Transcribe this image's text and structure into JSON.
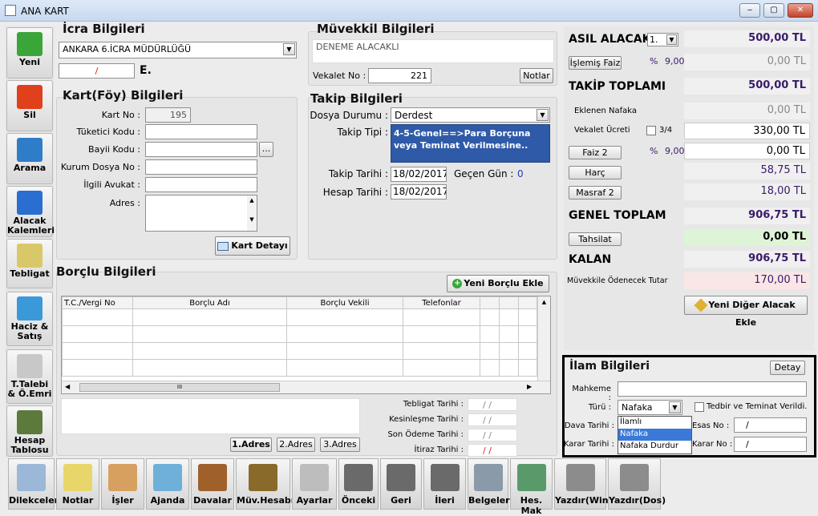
{
  "window": {
    "title": "ANA KART",
    "min": "‒",
    "max": "▢",
    "close": "✕"
  },
  "left_toolbar": [
    {
      "label": "Yeni",
      "icon": "new-plus-icon",
      "color": "#3aa63a"
    },
    {
      "label": "Sil",
      "icon": "delete-x-icon",
      "color": "#e0401c"
    },
    {
      "label": "Arama",
      "icon": "magnifier-icon",
      "color": "#2f7dc9"
    },
    {
      "label": "Alacak Kalemleri",
      "icon": "pencil-icon",
      "color": "#2a6ecf"
    },
    {
      "label": "Tebligat",
      "icon": "notification-envelope-icon",
      "color": "#d9c86a"
    },
    {
      "label": "Haciz & Satış",
      "icon": "pie-chart-icon",
      "color": "#3a9ad9"
    },
    {
      "label": "T.Talebi & Ö.Emri",
      "icon": "gavel-doc-icon",
      "color": "#c8c8c8"
    },
    {
      "label": "Hesap Tablosu",
      "icon": "blackboard-icon",
      "color": "#5c7a3c"
    }
  ],
  "icra": {
    "title": "İcra Bilgileri",
    "office": "ANKARA 6.İCRA MÜDÜRLÜĞÜ",
    "file_no": "/",
    "suffix": "E."
  },
  "muvekkil": {
    "title": "Müvekkil Bilgileri",
    "name": "DENEME ALACAKLI",
    "vekalet_label": "Vekalet No :",
    "vekalet_no": "221",
    "notlar": "Notlar"
  },
  "kart": {
    "title": "Kart(Föy) Bilgileri",
    "kart_no_label": "Kart No :",
    "kart_no": "195",
    "tuketici_label": "Tüketici Kodu :",
    "bayi_label": "Bayii Kodu :",
    "bayi_btn": "...",
    "kurum_label": "Kurum Dosya No :",
    "avukat_label": "İlgili Avukat :",
    "adres_label": "Adres :",
    "detay_btn": "Kart Detayı"
  },
  "takip": {
    "title": "Takip Bilgileri",
    "durum_label": "Dosya Durumu :",
    "durum": "Derdest",
    "tip_label": "Takip Tipi :",
    "tip": "4-5-Genel==>Para Borçuna veya Teminat Verilmesine..",
    "tarih_label": "Takip Tarihi :",
    "tarih": "18/02/2017",
    "gecen_label": "Geçen Gün :",
    "gecen": "0",
    "hesap_label": "Hesap Tarihi :",
    "hesap": "18/02/2017"
  },
  "borclu": {
    "title": "Borçlu Bilgileri",
    "add_btn": "Yeni Borçlu Ekle",
    "columns": [
      "T.C./Vergi No",
      "Borçlu Adı",
      "Borçlu Vekili",
      "Telefonlar"
    ],
    "scroll_grip": "III",
    "adres_btns": [
      "1.Adres",
      "2.Adres",
      "3.Adres"
    ],
    "dates": [
      {
        "label": "Tebligat Tarihi :",
        "value": "/ /"
      },
      {
        "label": "Kesinleşme Tarihi :",
        "value": "/ /"
      },
      {
        "label": "Son Ödeme Tarihi :",
        "value": "/ /"
      },
      {
        "label": "İtiraz Tarihi :",
        "value": "/ /"
      }
    ]
  },
  "summary": {
    "asil_label": "ASIL ALACAK",
    "asil_sel": "1.",
    "asil_value": "500,00 TL",
    "islemis_btn": "İşlemiş Faiz",
    "pct": "%",
    "rate1": "9,00",
    "islemis_value": "0,00 TL",
    "takip_label": "TAKİP TOPLAMI",
    "takip_value": "500,00 TL",
    "nafaka_label": "Eklenen Nafaka",
    "nafaka_value": "0,00 TL",
    "vekalet_label": "Vekalet Ücreti",
    "vekalet_chk": "3/4",
    "vekalet_value": "330,00 TL",
    "faiz2_btn": "Faiz 2",
    "rate2": "9,00",
    "info": "i",
    "faiz2_value": "0,00 TL",
    "harc_btn": "Harç",
    "harc_value": "58,75 TL",
    "masraf_btn": "Masraf 2",
    "masraf_value": "18,00 TL",
    "genel_label": "GENEL TOPLAM",
    "genel_value": "906,75 TL",
    "tahsilat_btn": "Tahsilat",
    "tahsilat_value": "0,00 TL",
    "kalan_label": "KALAN",
    "kalan_value": "906,75 TL",
    "muvekkile_label": "Müvekkile Ödenecek Tutar",
    "muvekkile_value": "170,00 TL",
    "diger_btn": "Yeni Diğer Alacak Ekle"
  },
  "ilam": {
    "title": "İlam Bilgileri",
    "detay_btn": "Detay",
    "mahkeme_label": "Mahkeme :",
    "turu_label": "Türü :",
    "turu": "Nafaka",
    "tedbir_label": "Tedbir ve Teminat Verildi.",
    "dava_label": "Dava Tarihi :",
    "karar_label": "Karar Tarihi :",
    "esas_label": "Esas No :",
    "esas": "/",
    "karar_no_label": "Karar No :",
    "karar_no": "/",
    "options": [
      "İlamlı",
      "Nafaka",
      "Nafaka Durdur"
    ],
    "selected": "Nafaka"
  },
  "bottom_toolbar": [
    {
      "label": "Dilekceler",
      "icon": "document-pen-icon",
      "color": "#9bb8d8"
    },
    {
      "label": "Notlar",
      "icon": "notepad-icon",
      "color": "#e8d66a"
    },
    {
      "label": "İşler",
      "icon": "clipboard-icon",
      "color": "#d8a060"
    },
    {
      "label": "Ajanda",
      "icon": "clock-calendar-icon",
      "color": "#6fb0d8"
    },
    {
      "label": "Davalar",
      "icon": "gavel-icon",
      "color": "#a0602c"
    },
    {
      "label": "Müv.Hesabı",
      "icon": "wallet-icon",
      "color": "#8a6a2a"
    },
    {
      "label": "Ayarlar",
      "icon": "settings-icon",
      "color": "#bdbdbd"
    },
    {
      "label": "Önceki",
      "icon": "arrow-up-icon",
      "color": "#6a6a6a"
    },
    {
      "label": "Geri",
      "icon": "arrow-left-icon",
      "color": "#6a6a6a"
    },
    {
      "label": "İleri",
      "icon": "arrow-right-icon",
      "color": "#6a6a6a"
    },
    {
      "label": "Belgeler",
      "icon": "scanner-icon",
      "color": "#8a9aa8"
    },
    {
      "label": "Hes. Mak",
      "icon": "calculator-icon",
      "color": "#5a9a6a"
    },
    {
      "label": "Yazdır(Win)",
      "icon": "printer-icon",
      "color": "#8c8c8c"
    },
    {
      "label": "Yazdır(Dos)",
      "icon": "dot-matrix-printer-icon",
      "color": "#8c8c8c"
    }
  ]
}
